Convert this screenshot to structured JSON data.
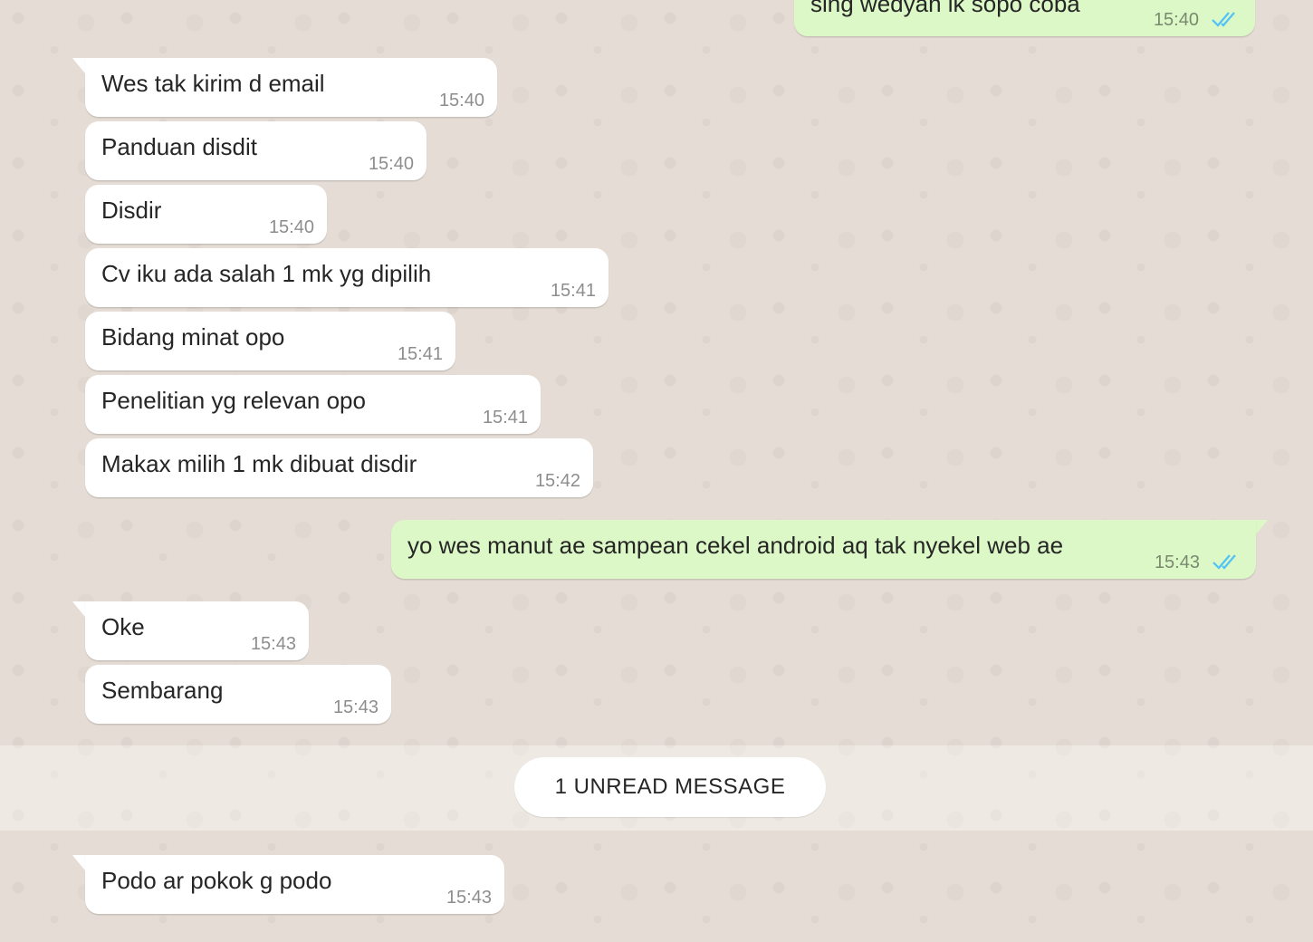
{
  "chat": {
    "messages": [
      {
        "direction": "out",
        "text": "sing wedyan ik sopo coba",
        "time": "15:40",
        "status": "read"
      },
      {
        "direction": "in",
        "text": "Wes tak kirim d email",
        "time": "15:40"
      },
      {
        "direction": "in",
        "text": "Panduan disdit",
        "time": "15:40"
      },
      {
        "direction": "in",
        "text": "Disdir",
        "time": "15:40"
      },
      {
        "direction": "in",
        "text": "Cv iku ada salah 1 mk yg dipilih",
        "time": "15:41"
      },
      {
        "direction": "in",
        "text": "Bidang minat opo",
        "time": "15:41"
      },
      {
        "direction": "in",
        "text": "Penelitian yg relevan opo",
        "time": "15:41"
      },
      {
        "direction": "in",
        "text": "Makax milih 1 mk dibuat disdir",
        "time": "15:42"
      },
      {
        "direction": "out",
        "text": "yo wes manut ae sampean cekel android aq tak nyekel web ae",
        "time": "15:43",
        "status": "read"
      },
      {
        "direction": "in",
        "text": "Oke",
        "time": "15:43"
      },
      {
        "direction": "in",
        "text": "Sembarang",
        "time": "15:43"
      },
      {
        "direction": "in",
        "text": "Podo ar pokok g podo",
        "time": "15:43"
      }
    ],
    "unread_divider": {
      "label": "1 UNREAD MESSAGE"
    }
  },
  "colors": {
    "wallpaper": "#e5ddd5",
    "incoming_bubble": "#ffffff",
    "outgoing_bubble": "#dcf8c6",
    "read_ticks": "#4fc3f7"
  }
}
